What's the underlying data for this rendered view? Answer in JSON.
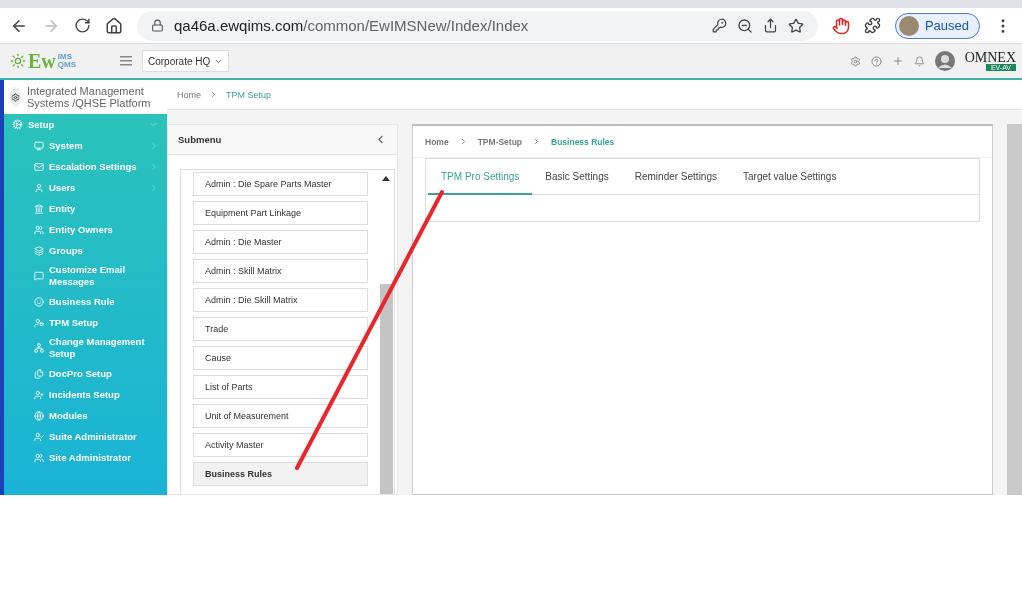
{
  "browser": {
    "url_host": "qa46a.ewqims.com",
    "url_path": "/common/EwIMSNew/Index/Index",
    "profile_label": "Paused"
  },
  "header": {
    "logo": {
      "main": "Ew",
      "sup": "IMS",
      "sub": "QMS"
    },
    "site_select": "Corporate HQ",
    "brand": {
      "name": "OMNEX",
      "tag": "EV-AV"
    }
  },
  "sidebar": {
    "title": "Integrated Management Systems /QHSE Platform",
    "items": [
      {
        "label": "Setup",
        "expanded": true,
        "children": [
          {
            "label": "System",
            "expandable": true
          },
          {
            "label": "Escalation Settings",
            "expandable": true
          },
          {
            "label": "Users",
            "expandable": true
          },
          {
            "label": "Entity",
            "expandable": false
          },
          {
            "label": "Entity Owners",
            "expandable": false
          },
          {
            "label": "Groups",
            "expandable": false
          },
          {
            "label": "Customize Email Messages",
            "expandable": false
          },
          {
            "label": "Business Rule",
            "expandable": false
          },
          {
            "label": "TPM Setup",
            "expandable": false
          },
          {
            "label": "Change Management Setup",
            "expandable": false
          },
          {
            "label": "DocPro Setup",
            "expandable": false
          },
          {
            "label": "Incidents Setup",
            "expandable": false
          },
          {
            "label": "Modules",
            "expandable": false
          },
          {
            "label": "Suite Administrator",
            "expandable": false
          },
          {
            "label": "Site Administrator",
            "expandable": false
          }
        ]
      }
    ]
  },
  "breadcrumb": [
    "Home",
    "TPM Setup"
  ],
  "submenu": {
    "title": "Submenu",
    "items": [
      {
        "label": "Admin : Die Spare Parts Master",
        "selected": false
      },
      {
        "label": "Equipment Part Linkage",
        "selected": false
      },
      {
        "label": "Admin : Die Master",
        "selected": false
      },
      {
        "label": "Admin : Skill Matrix",
        "selected": false
      },
      {
        "label": "Admin : Die Skill Matrix",
        "selected": false
      },
      {
        "label": "Trade",
        "selected": false
      },
      {
        "label": "Cause",
        "selected": false
      },
      {
        "label": "List of Parts",
        "selected": false
      },
      {
        "label": "Unit of Measurement",
        "selected": false
      },
      {
        "label": "Activity Master",
        "selected": false
      },
      {
        "label": "Business Rules",
        "selected": true
      }
    ]
  },
  "content": {
    "breadcrumb": [
      "Home",
      "TPM-Setup",
      "Business Rules"
    ],
    "tabs": [
      {
        "label": "TPM Pro Settings",
        "selected": true
      },
      {
        "label": "Basic Settings",
        "selected": false
      },
      {
        "label": "Reminder Settings",
        "selected": false
      },
      {
        "label": "Target value Settings",
        "selected": false
      }
    ]
  }
}
